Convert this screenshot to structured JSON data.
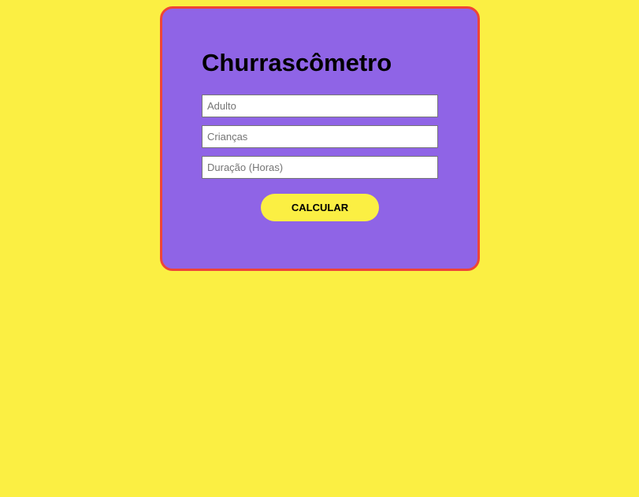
{
  "colors": {
    "page_background": "#fbef43",
    "card_background": "#8f64e6",
    "card_border": "#ef4536",
    "button_background": "#fbef43"
  },
  "card": {
    "title": "Churrascômetro",
    "fields": {
      "adults": {
        "placeholder": "Adulto",
        "value": ""
      },
      "children": {
        "placeholder": "Crianças",
        "value": ""
      },
      "duration": {
        "placeholder": "Duração (Horas)",
        "value": ""
      }
    },
    "calculate_label": "CALCULAR"
  }
}
